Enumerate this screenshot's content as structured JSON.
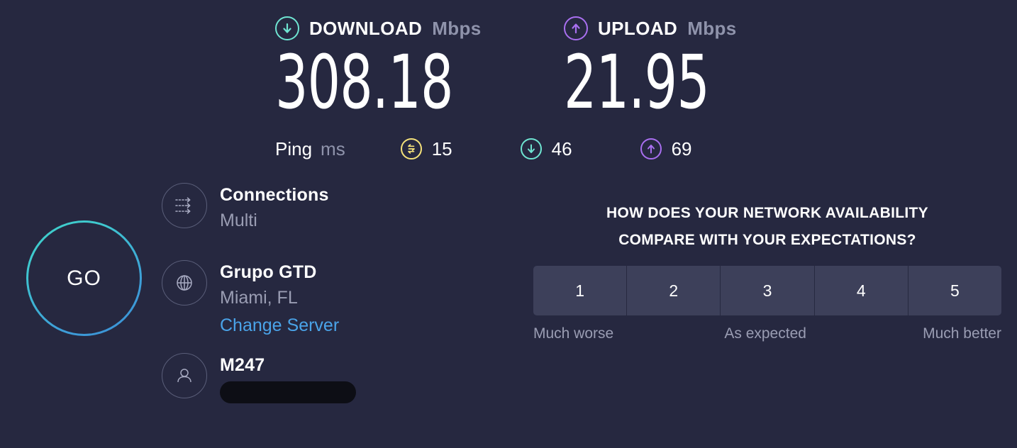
{
  "theme": {
    "background": "#262840",
    "download_accent": "#6fe5d2",
    "upload_accent": "#a96ff0",
    "idle_accent": "#f5e27a",
    "link_color": "#4aa3e8",
    "muted_text": "#9a9db3",
    "button_bg": "#3d405a"
  },
  "results": {
    "download": {
      "label": "DOWNLOAD",
      "unit": "Mbps",
      "value": "308.18",
      "icon": "arrow-down-circle-icon"
    },
    "upload": {
      "label": "UPLOAD",
      "unit": "Mbps",
      "value": "21.95",
      "icon": "arrow-up-circle-icon"
    },
    "ping": {
      "label": "Ping",
      "unit": "ms",
      "idle": {
        "icon": "idle-latency-icon",
        "value": "15"
      },
      "download": {
        "icon": "arrow-down-circle-icon",
        "value": "46"
      },
      "upload": {
        "icon": "arrow-up-circle-icon",
        "value": "69"
      }
    }
  },
  "go_button": {
    "label": "GO"
  },
  "connection_info": {
    "connections": {
      "icon": "multi-connection-icon",
      "title": "Connections",
      "value": "Multi"
    },
    "server": {
      "icon": "globe-icon",
      "title": "Grupo GTD",
      "location": "Miami, FL",
      "change_link": "Change Server"
    },
    "isp": {
      "icon": "person-icon",
      "title": "M247",
      "ip_redacted": true
    }
  },
  "survey": {
    "question_line1": "HOW DOES YOUR NETWORK AVAILABILITY",
    "question_line2": "COMPARE WITH YOUR EXPECTATIONS?",
    "options": [
      "1",
      "2",
      "3",
      "4",
      "5"
    ],
    "scale_low": "Much worse",
    "scale_mid": "As expected",
    "scale_high": "Much better"
  }
}
